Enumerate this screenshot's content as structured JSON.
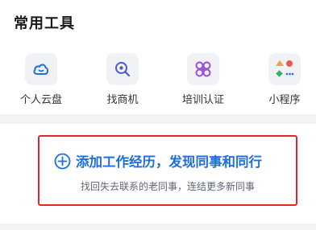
{
  "tools": {
    "title": "常用工具",
    "items": [
      {
        "label": "个人云盘",
        "icon": "cloud-drive-icon",
        "color": "#1d6fe0"
      },
      {
        "label": "找商机",
        "icon": "search-business-icon",
        "color": "#4b57d6"
      },
      {
        "label": "培训认证",
        "icon": "training-flower-icon",
        "color": "#9a4fd4"
      },
      {
        "label": "小程序",
        "icon": "mini-program-grid-icon",
        "color": "#e85a4f"
      }
    ]
  },
  "banner": {
    "title": "添加工作经历，发现同事和同行",
    "subtitle": "找回失去联系的老同事，连结更多新同事",
    "accent_color": "#1d6fe0",
    "highlight_color": "#e02a20"
  }
}
